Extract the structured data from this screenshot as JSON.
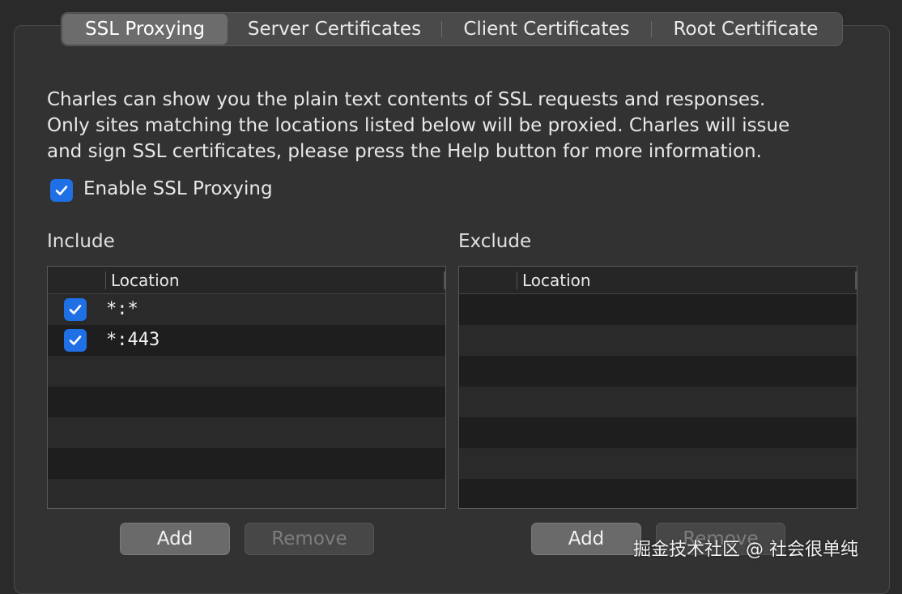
{
  "tabs": [
    {
      "label": "SSL Proxying",
      "active": true
    },
    {
      "label": "Server Certificates",
      "active": false
    },
    {
      "label": "Client Certificates",
      "active": false
    },
    {
      "label": "Root Certificate",
      "active": false
    }
  ],
  "description": {
    "line1": "Charles can show you the plain text contents of SSL requests and responses.",
    "line2": "Only sites matching the locations listed below will be proxied. Charles will issue",
    "line3": "and sign SSL certificates, please press the Help button for more information."
  },
  "enable_ssl": {
    "label": "Enable SSL Proxying",
    "checked": true
  },
  "include": {
    "title": "Include",
    "column_header": "Location",
    "rows": [
      {
        "location": "*:*",
        "checked": true
      },
      {
        "location": "*:443",
        "checked": true
      }
    ],
    "add_label": "Add",
    "remove_label": "Remove"
  },
  "exclude": {
    "title": "Exclude",
    "column_header": "Location",
    "rows": [],
    "add_label": "Add",
    "remove_label": "Remove"
  },
  "colors": {
    "accent": "#1f6fe5",
    "background": "#323232"
  },
  "watermark": "掘金技术社区 @ 社会很单纯"
}
